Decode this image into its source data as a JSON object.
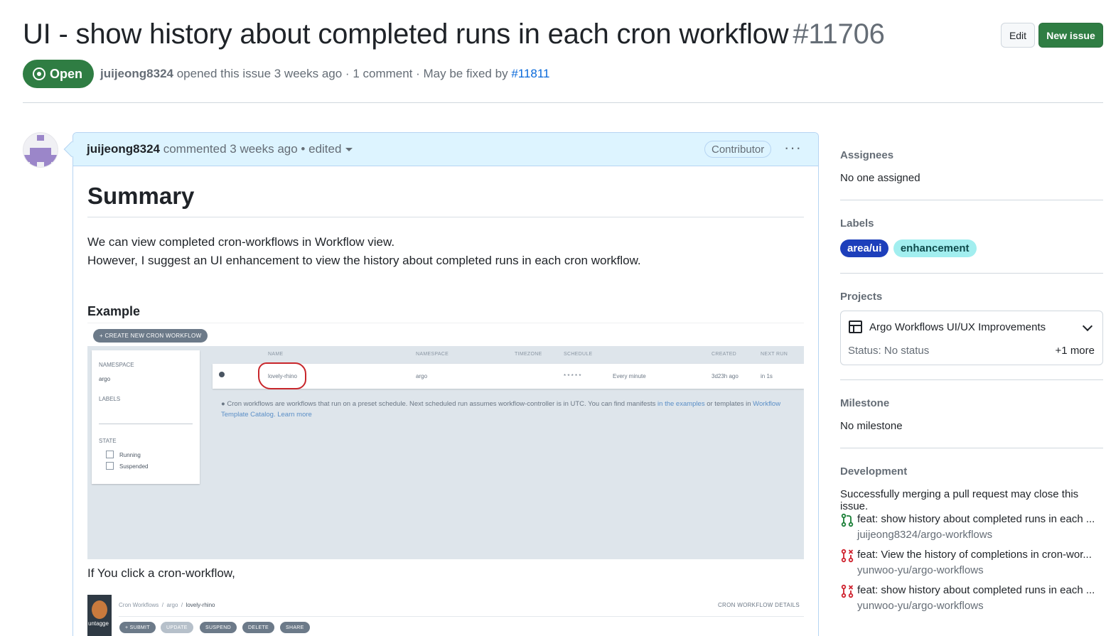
{
  "issue": {
    "title": "UI - show history about completed runs in each cron workflow",
    "number": "#11706",
    "state": "Open",
    "author": "juijeong8324",
    "opened_text": "opened this issue 3 weeks ago · 1 comment · May be fixed by",
    "fixed_by": "#11811"
  },
  "header_buttons": {
    "edit": "Edit",
    "new_issue": "New issue"
  },
  "comment": {
    "author": "juijeong8324",
    "meta": "commented 3 weeks ago • edited",
    "role": "Contributor",
    "kebab": "···",
    "heading": "Summary",
    "para_line1": "We can view completed cron-workflows in Workflow view.",
    "para_line2": "However, I suggest an UI enhancement to view the history about completed runs in each cron workflow.",
    "example_heading": "Example",
    "click_text": "If You click a cron-workflow,"
  },
  "embedded_screenshot": {
    "create_button": "+ CREATE NEW CRON WORKFLOW",
    "namespace_label": "NAMESPACE",
    "namespace_value": "argo",
    "labels_label": "LABELS",
    "state_label": "STATE",
    "state_running": "Running",
    "state_suspended": "Suspended",
    "columns": [
      "NAME",
      "NAMESPACE",
      "TIMEZONE",
      "SCHEDULE",
      "CREATED",
      "NEXT RUN"
    ],
    "row": {
      "name": "lovely-rhino",
      "namespace": "argo",
      "schedule": "* * * * *",
      "schedule_text": "Every minute",
      "created": "3d23h ago",
      "next_run": "in 1s"
    },
    "info_text": "Cron workflows are workflows that run on a preset schedule. Next scheduled run assumes workflow-controller is in UTC. You can find manifests",
    "info_link1": "in the examples",
    "info_mid": "or templates in",
    "info_link2": "Workflow Template Catalog",
    "info_link3": "Learn more"
  },
  "embedded_screenshot2": {
    "logo_text": "untagge",
    "breadcrumb1": "Cron Workflows",
    "breadcrumb2": "argo",
    "breadcrumb3": "lovely-rhino",
    "details": "CRON WORKFLOW DETAILS",
    "buttons": [
      "+ SUBMIT",
      "UPDATE",
      "SUSPEND",
      "DELETE",
      "SHARE"
    ]
  },
  "sidebar": {
    "assignees_title": "Assignees",
    "assignees_value": "No one assigned",
    "labels_title": "Labels",
    "labels": [
      {
        "name": "area/ui",
        "color": "#1d3fbb",
        "text_color": "#ffffff"
      },
      {
        "name": "enhancement",
        "color": "#a2eeef",
        "text_color": "#0e4a4b"
      }
    ],
    "projects_title": "Projects",
    "project_name": "Argo Workflows UI/UX Improvements",
    "project_status": "Status: No status",
    "project_more": "+1 more",
    "milestone_title": "Milestone",
    "milestone_value": "No milestone",
    "development_title": "Development",
    "development_note": "Successfully merging a pull request may close this issue.",
    "pull_requests": [
      {
        "title": "feat: show history about completed runs in each ...",
        "repo": "juijeong8324/argo-workflows",
        "status": "open",
        "color": "#1a7f37"
      },
      {
        "title": "feat: View the history of completions in cron-wor...",
        "repo": "yunwoo-yu/argo-workflows",
        "status": "closed",
        "color": "#cf222e"
      },
      {
        "title": "feat: show history about completed runs in each ...",
        "repo": "yunwoo-yu/argo-workflows",
        "status": "closed",
        "color": "#cf222e"
      }
    ]
  }
}
